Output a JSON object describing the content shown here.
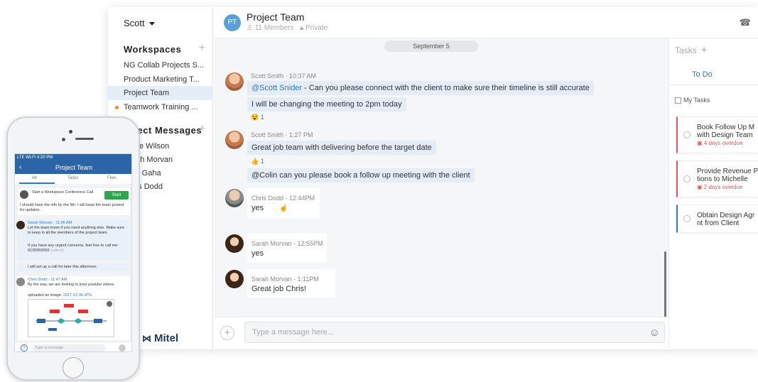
{
  "sidebar": {
    "user": "Scott",
    "workspaces_header": "Workspaces",
    "add_symbol": "+",
    "workspaces": [
      {
        "label": "NG Collab Projects S..."
      },
      {
        "label": "Product Marketing T..."
      },
      {
        "label": "Project Team"
      },
      {
        "label": "Teamwork Training ..."
      }
    ],
    "dm_header": "Direct Messages",
    "direct_messages": [
      {
        "label": "Steve Wilson"
      },
      {
        "label": "Sarah Morvan"
      },
      {
        "label": "Julie Gaha"
      },
      {
        "label": "Chris Dodd"
      }
    ],
    "brand": "Mitel"
  },
  "header": {
    "avatar_initials": "PT",
    "title": "Project Team",
    "members": "11 Members",
    "privacy": "Private"
  },
  "chat": {
    "date": "September 5",
    "messages": [
      {
        "author_time": "Scott Smith  · 10:37 AM",
        "mention": "@Scott Snider",
        "text": " - Can you please connect with the client to make sure their timeline is still accurate"
      },
      {
        "text": "I will be changing the meeting to 2pm today"
      },
      {
        "reaction": "😵 1"
      },
      {
        "author_time": "Scott Smith  · 1:27 PM",
        "text": "Great job team with delivering before the target date"
      },
      {
        "reaction": "👍 1"
      },
      {
        "text": "@Colin can you please  book a follow up meeting with the client"
      },
      {
        "author_time": "Chris Dodd  - 12:44PM",
        "text": "yes"
      },
      {
        "author_time": "Sarah Morvan  - 12:55PM",
        "text": "yes"
      },
      {
        "author_time": "Sarah Morvan  - 1:11PM",
        "text": "Great job Chris!"
      }
    ]
  },
  "composer": {
    "placeholder": "Type a message here...",
    "plus": "+",
    "emoji": "☺"
  },
  "tasks": {
    "title": "Tasks",
    "plus": "+",
    "tab": "To Do",
    "filter": "My Tasks",
    "items": [
      {
        "title_line1": "Book Follow Up M",
        "title_line2": "with Design Team",
        "due": "4 days overdue"
      },
      {
        "title_line1": "Provide Revenue P",
        "title_line2": "tions to Michelle",
        "due": "2 days overdue"
      },
      {
        "title_line1": "Obtain Design Agr",
        "title_line2": "nt from Client",
        "due": ""
      }
    ]
  },
  "phone": {
    "status": "LTE  Wi-Fi            4:20 PM",
    "nav_title": "Project Team",
    "tabs": [
      "All",
      "Tasks",
      "Files"
    ],
    "card1_title": "Start a Workspace Conference Call",
    "start": "Start",
    "card1_text": "I should have the info by the 9th. I will keep the team posted for updates.",
    "msg1_author": "Sarah Morvan",
    "msg1_time": "11:06 AM",
    "msg1_text": "Let the team know if you need anything else. Make sure to keep in all the members of the project team.",
    "msg2_text": "If you have any urgent concerns, feel free to call me: 6135550055",
    "msg2_tag": "(edited)",
    "msg3_text": "I will set up a call for later this afternoon",
    "msg4_author": "Chris Dodd",
    "msg4_time": "11:47 AM",
    "msg4_text": "By the way, we are looking to post youtube videos",
    "upload_text": "uploaded an image:",
    "upload_link": "2017-12-30.JPG",
    "input_placeholder": "Type a message"
  }
}
